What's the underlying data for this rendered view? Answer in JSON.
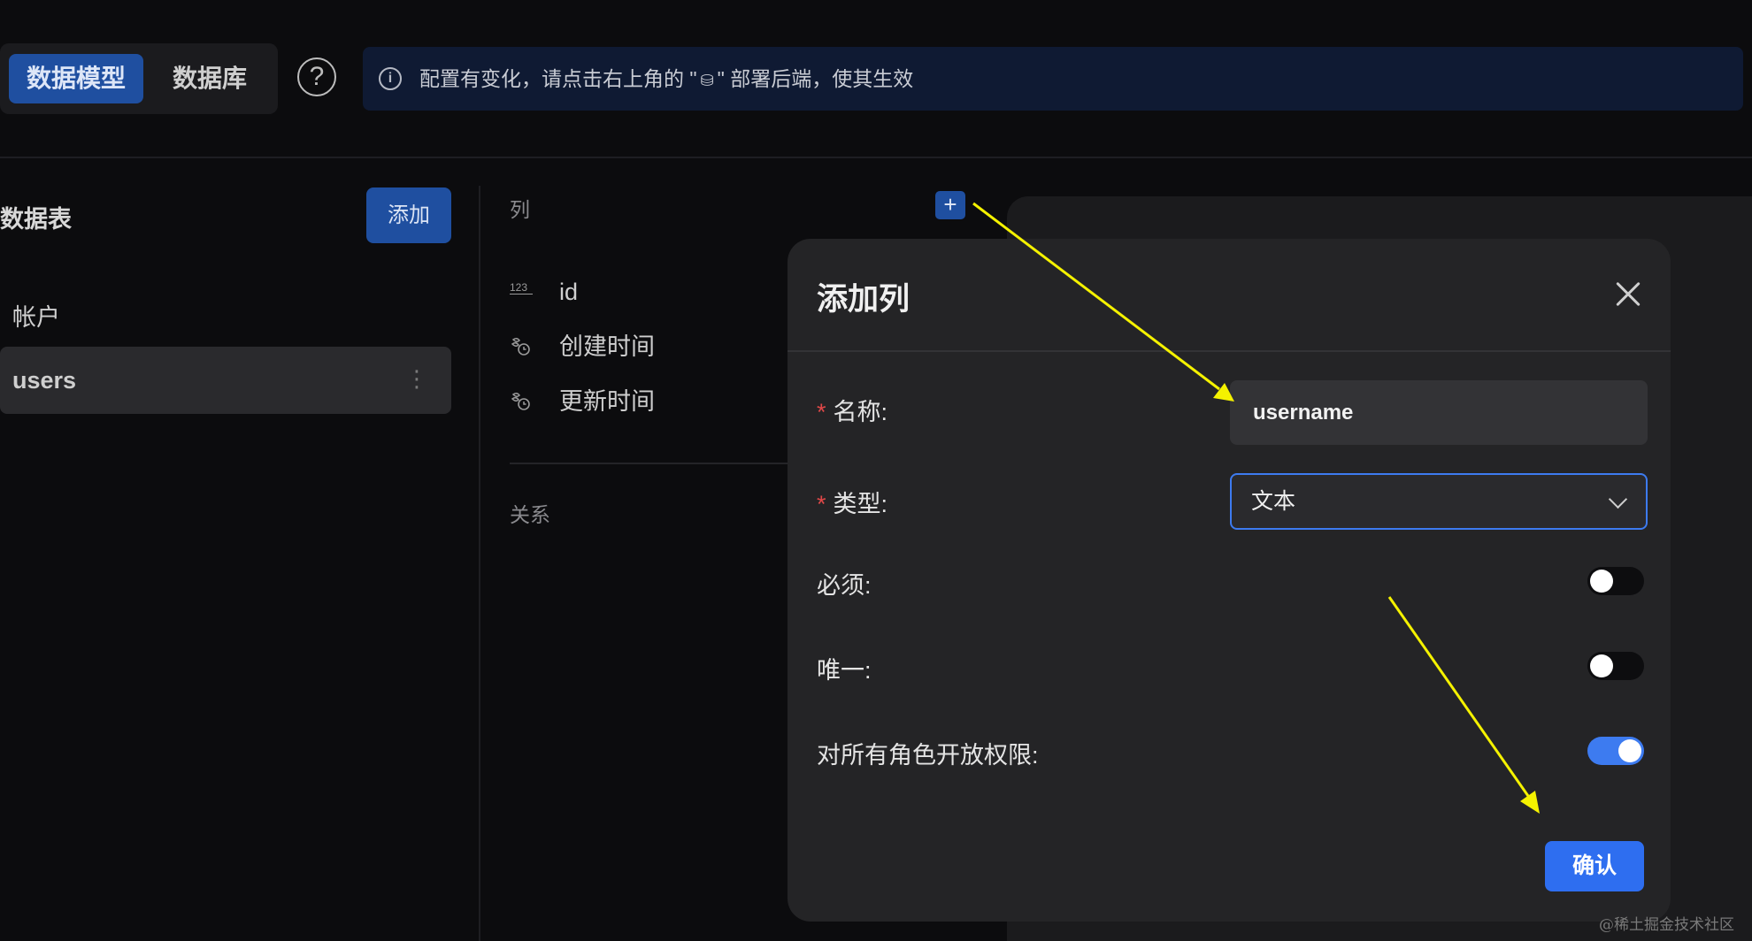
{
  "header": {
    "tabs": [
      {
        "label": "数据模型",
        "active": true
      },
      {
        "label": "数据库",
        "active": false
      }
    ],
    "help_icon": "question-circle-icon",
    "banner": {
      "icon": "info-circle-icon",
      "text_before": "配置有变化，请点击右上角的 \"",
      "glyph": "⛁",
      "text_after": "\" 部署后端，使其生效"
    }
  },
  "sidebar": {
    "title": "数据表",
    "add_label": "添加",
    "group_label": "帐户",
    "items": [
      {
        "label": "users",
        "more_glyph": "⋮",
        "selected": true
      }
    ]
  },
  "columns": {
    "label": "列",
    "add_glyph": "+",
    "items": [
      {
        "icon": "number-type-icon",
        "icon_text": "123",
        "label": "id"
      },
      {
        "icon": "time-type-icon",
        "icon_text": "",
        "label": "创建时间"
      },
      {
        "icon": "time-type-icon",
        "icon_text": "",
        "label": "更新时间"
      }
    ],
    "relations_label": "关系"
  },
  "modal": {
    "title": "添加列",
    "fields": {
      "name": {
        "label": "名称:",
        "required": true,
        "value": "username"
      },
      "type": {
        "label": "类型:",
        "required": true,
        "value": "文本"
      },
      "required_toggle": {
        "label": "必须:",
        "on": false
      },
      "unique_toggle": {
        "label": "唯一:",
        "on": false
      },
      "open_permission_toggle": {
        "label": "对所有角色开放权限:",
        "on": true
      }
    },
    "required_mark": "*",
    "confirm_label": "确认"
  },
  "colors": {
    "accent": "#3d7bf0",
    "primary_dark": "#1f4fa0",
    "required": "#e04848",
    "arrow": "#f5f200"
  },
  "watermark": "@稀土掘金技术社区"
}
